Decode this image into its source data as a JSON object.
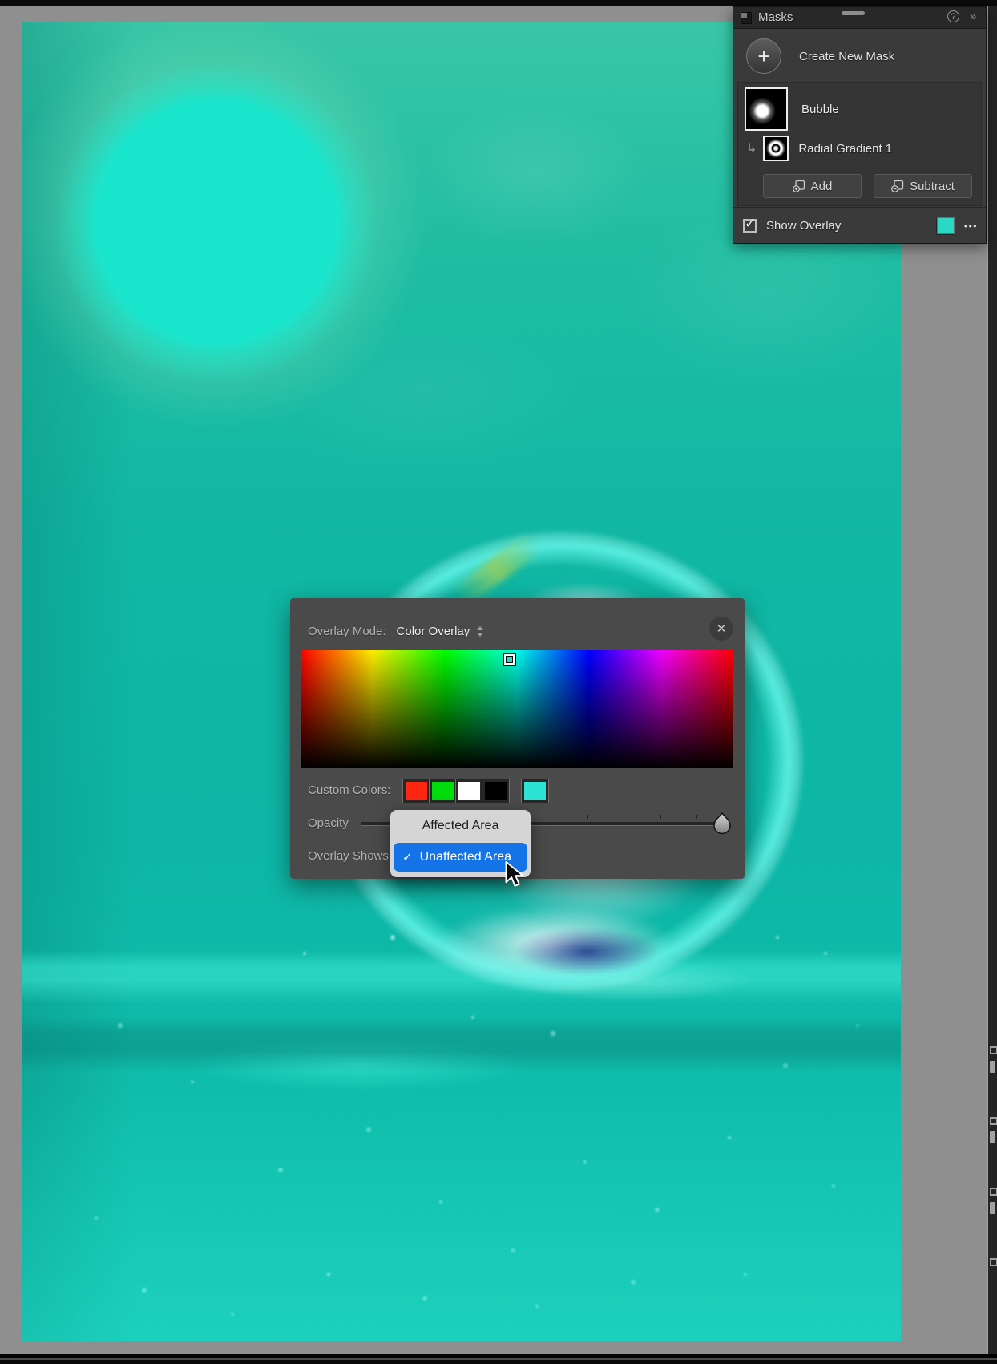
{
  "masks_panel": {
    "title": "Masks",
    "help_glyph": "?",
    "collapse_glyph": "»",
    "plus_glyph": "+",
    "create_new_mask_label": "Create New Mask",
    "masks": [
      {
        "name": "Bubble"
      },
      {
        "name": "Radial Gradient 1"
      }
    ],
    "sub_arrow_glyph": "↳",
    "add_label": "Add",
    "subtract_label": "Subtract",
    "show_overlay_label": "Show Overlay",
    "show_overlay_checked": true,
    "check_glyph": "✓",
    "overlay_swatch_color": "#2bd8c6",
    "more_glyph": "•••"
  },
  "overlay_dialog": {
    "mode_label": "Overlay Mode:",
    "mode_value": "Color Overlay",
    "close_glyph": "✕",
    "picker_hues": [
      "#ff0000",
      "#fff000",
      "#00ff00",
      "#00ffe8",
      "#0000ff",
      "#f000ff",
      "#ff0000"
    ],
    "selected_marker_color": "#2bd8c6",
    "custom_colors_label": "Custom Colors:",
    "custom_colors": [
      "#ff2612",
      "#00dd0c",
      "#ffffff",
      "#000000"
    ],
    "active_custom_color": "#2ce4d4",
    "opacity_label": "Opacity",
    "overlay_shows_label": "Overlay Shows:",
    "check_glyph": "✓",
    "selection_color": "#1473e6",
    "dropdown_options": [
      {
        "label": "Affected Area",
        "selected": false
      },
      {
        "label": "Unaffected Area",
        "selected": true
      }
    ]
  }
}
